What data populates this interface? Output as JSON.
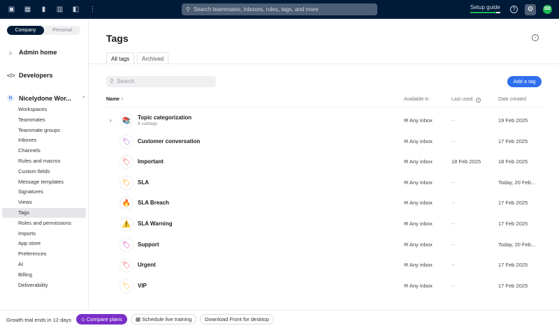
{
  "topbar": {
    "icons": [
      "inbox-icon",
      "calendar-icon",
      "contacts-icon",
      "analytics-icon",
      "columns-icon",
      "more-icon"
    ],
    "search_placeholder": "Search teammates, inboxes, rules, tags, and more",
    "setup_guide": "Setup guide",
    "setup_progress": 0.85,
    "avatar": "BB"
  },
  "sidebar": {
    "segment": {
      "company": "Company",
      "personal": "Personal"
    },
    "admin_home": "Admin home",
    "developers": "Developers",
    "workspace_initial": "N",
    "workspace": "Nicelydone Wor...",
    "items": [
      "Workspaces",
      "Teammates",
      "Teammate groups",
      "Inboxes",
      "Channels",
      "Rules and macros",
      "Custom fields",
      "Message templates",
      "Signatures",
      "Views",
      "Tags",
      "Roles and permissions",
      "Imports",
      "App store",
      "Preferences",
      "AI",
      "Billing",
      "Deliverability"
    ],
    "active": "Tags"
  },
  "main": {
    "title": "Tags",
    "tabs": [
      "All tags",
      "Archived"
    ],
    "search_placeholder": "Search",
    "add_button": "Add a tag",
    "columns": {
      "name": "Name ↑",
      "available": "Available in",
      "last_used": "Last used",
      "created": "Date created"
    },
    "rows": [
      {
        "emoji": "📚",
        "name": "Topic categorization",
        "subtags": "8 subtags",
        "available": "Any inbox",
        "last_used": "--",
        "created": "19 Feb 2025"
      },
      {
        "emoji": "🏷",
        "name": "Customer conversation",
        "available": "Any inbox",
        "last_used": "--",
        "created": "17 Feb 2025"
      },
      {
        "emoji": "🏷",
        "name": "Important",
        "available": "Any inbox",
        "last_used": "18 Feb 2025",
        "created": "18 Feb 2025"
      },
      {
        "emoji": "🏷",
        "name": "SLA",
        "available": "Any inbox",
        "last_used": "--",
        "created": "Today, 20 Feb..."
      },
      {
        "emoji": "🔥",
        "name": "SLA Breach",
        "available": "Any inbox",
        "last_used": "--",
        "created": "17 Feb 2025"
      },
      {
        "emoji": "⚠️",
        "name": "SLA Warning",
        "available": "Any inbox",
        "last_used": "--",
        "created": "17 Feb 2025"
      },
      {
        "emoji": "🏷",
        "name": "Support",
        "available": "Any inbox",
        "last_used": "--",
        "created": "Today, 20 Feb..."
      },
      {
        "emoji": "🏷",
        "name": "Urgent",
        "available": "Any inbox",
        "last_used": "--",
        "created": "17 Feb 2025"
      },
      {
        "emoji": "🏷",
        "name": "VIP",
        "available": "Any inbox",
        "last_used": "--",
        "created": "17 Feb 2025"
      }
    ]
  },
  "footer": {
    "trial": "Growth trial ends in 12 days",
    "compare": "Compare plans",
    "schedule": "Schedule live training",
    "download": "Download Front for desktop"
  },
  "colors": {
    "topbar": "#001b38",
    "accent": "#2f6ff0",
    "purple": "#7b2fc9",
    "progress": "#1db954"
  }
}
